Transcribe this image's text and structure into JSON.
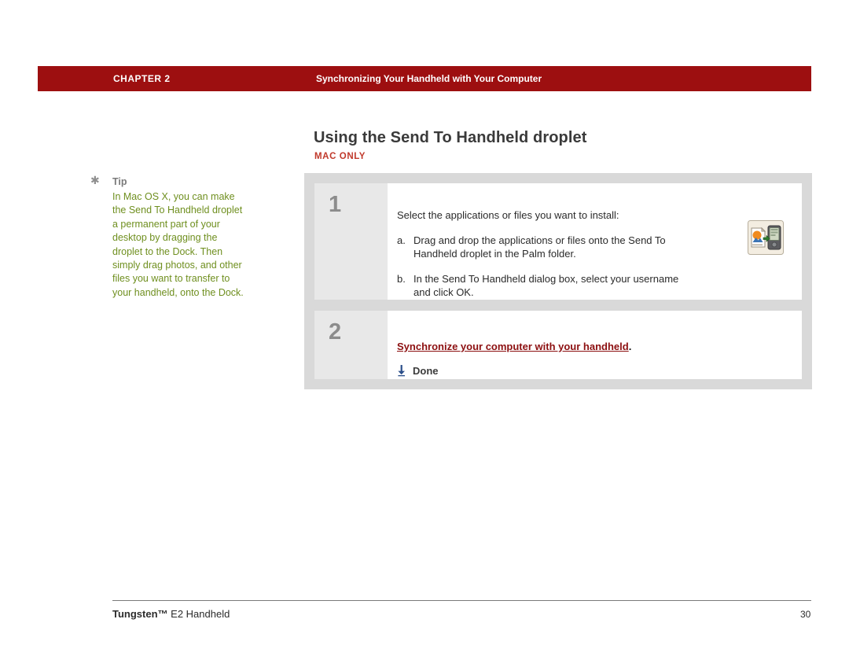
{
  "header": {
    "chapter": "CHAPTER 2",
    "title": "Synchronizing Your Handheld with Your Computer",
    "bar_color": "#9d0f10"
  },
  "page": {
    "title": "Using the Send To Handheld droplet",
    "mac_only": "MAC ONLY"
  },
  "tip": {
    "label": "Tip",
    "body": "In Mac OS X, you can make the Send To Handheld droplet a permanent part of your desktop by dragging the droplet to the Dock. Then simply drag photos, and other files you want to transfer to your handheld, onto the Dock.",
    "text_color": "#6f8f1f"
  },
  "steps": [
    {
      "number": "1",
      "intro": "Select the applications or files you want to install:",
      "substeps": [
        {
          "letter": "a.",
          "text": "Drag and drop the applications or files onto the Send To Handheld droplet in the Palm folder."
        },
        {
          "letter": "b.",
          "text": "In the Send To Handheld dialog box, select your username and click OK."
        }
      ],
      "icon": "send-to-handheld-droplet-icon"
    },
    {
      "number": "2",
      "link_text": "Synchronize your computer with your handheld",
      "trailing_text": ".",
      "done_label": "Done",
      "done_icon": "down-arrow-icon",
      "link_color": "#8c0f10"
    }
  ],
  "footer": {
    "brand": "Tungsten™",
    "model": " E2 Handheld",
    "page_number": "30"
  }
}
